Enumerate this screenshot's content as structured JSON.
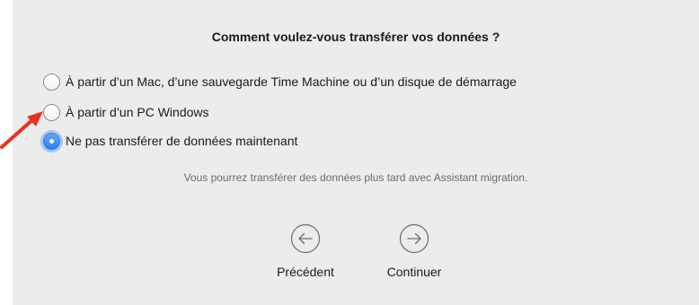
{
  "dialog": {
    "title": "Comment voulez-vous transférer vos données ?",
    "options": [
      {
        "label": "À partir d’un Mac, d’une sauvegarde Time Machine ou d’un disque de démarrage",
        "selected": false
      },
      {
        "label": "À partir d’un PC Windows",
        "selected": false
      },
      {
        "label": "Ne pas transférer de données maintenant",
        "selected": true
      }
    ],
    "hint": "Vous pourrez transférer des données plus tard avec Assistant migration.",
    "back_label": "Précédent",
    "continue_label": "Continuer"
  },
  "icons": {
    "back": "arrow-left-circle-icon",
    "continue": "arrow-right-circle-icon",
    "annotation": "red-arrow-icon"
  },
  "colors": {
    "panel_background": "#ececec",
    "accent": "#2f80ea",
    "annotation": "#e8321e"
  }
}
